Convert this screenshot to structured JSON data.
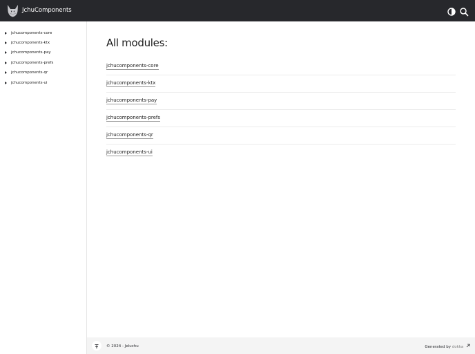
{
  "header": {
    "logo_icon": "cat-logo-icon",
    "title": "JchuComponents",
    "theme_icon": "theme-toggle-icon",
    "search_icon": "search-icon",
    "background": "#27282c"
  },
  "sidebar": {
    "items": [
      {
        "label": "jchucomponents-core"
      },
      {
        "label": "jchucomponents-ktx"
      },
      {
        "label": "jchucomponents-pay"
      },
      {
        "label": "jchucomponents-prefs"
      },
      {
        "label": "jchucomponents-qr"
      },
      {
        "label": "jchucomponents-ui"
      }
    ]
  },
  "main": {
    "heading": "All modules:",
    "modules": [
      {
        "name": "jchucomponents-core"
      },
      {
        "name": "jchucomponents-ktx"
      },
      {
        "name": "jchucomponents-pay"
      },
      {
        "name": "jchucomponents-prefs"
      },
      {
        "name": "jchucomponents-qr"
      },
      {
        "name": "jchucomponents-ui"
      }
    ]
  },
  "footer": {
    "up_icon": "scroll-to-top-icon",
    "copyright": "© 2024 - Jeluchu",
    "generated_prefix": "Generated by ",
    "generated_link": "dokka",
    "external_icon": "external-link-icon"
  }
}
